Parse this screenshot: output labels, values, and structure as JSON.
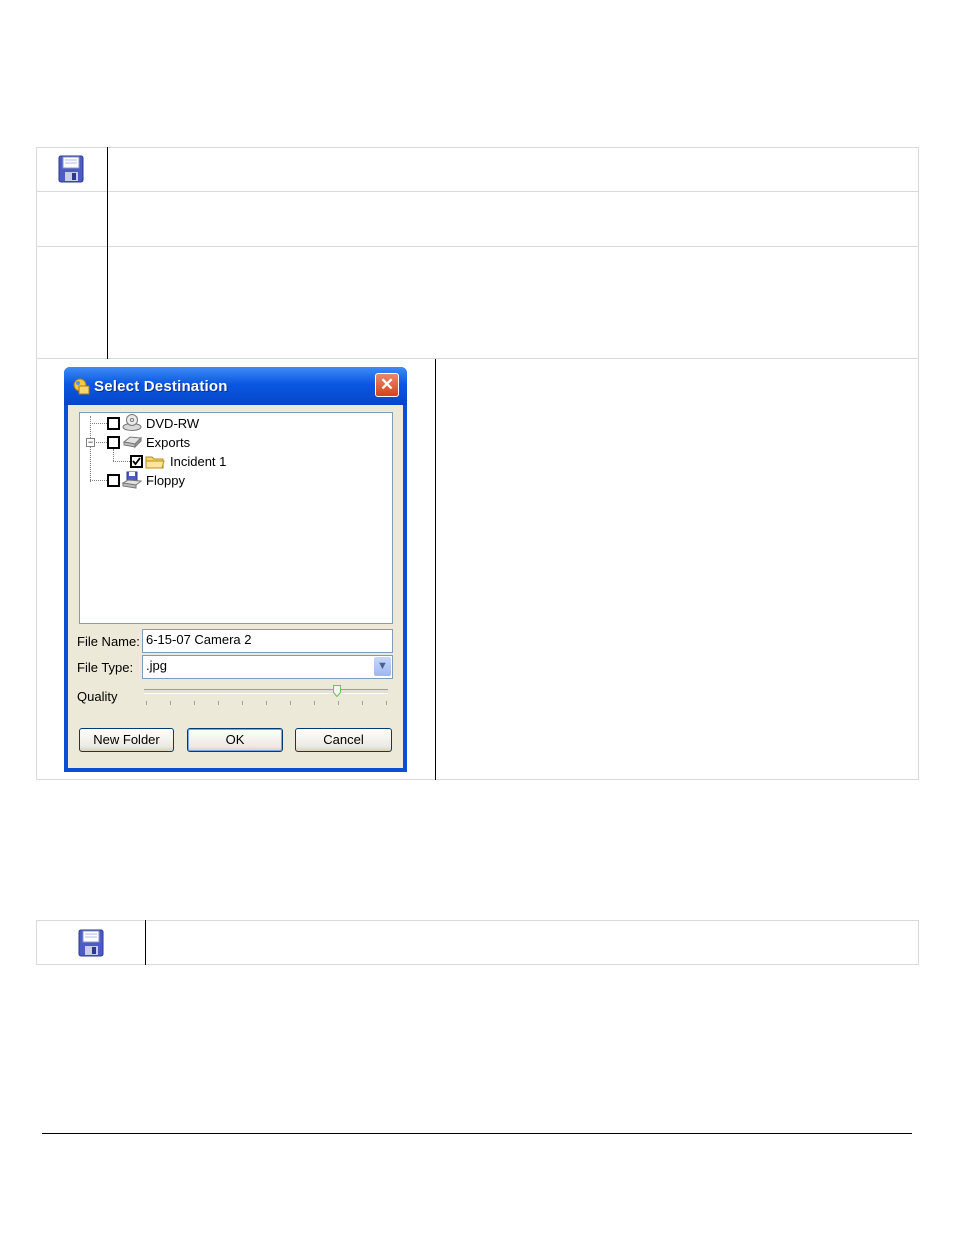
{
  "dialog": {
    "title": "Select Destination",
    "close_glyph": "✕",
    "tree": [
      {
        "label": "DVD-RW",
        "checked": false,
        "icon": "dvd-drive-icon"
      },
      {
        "label": "Exports",
        "checked": false,
        "icon": "hard-drive-icon",
        "expanded": true
      },
      {
        "label": "Incident 1",
        "checked": true,
        "icon": "folder-icon"
      },
      {
        "label": "Floppy",
        "checked": false,
        "icon": "floppy-drive-icon"
      }
    ],
    "file_name_label": "File Name:",
    "file_name_value": "6-15-07 Camera 2",
    "file_type_label": "File Type:",
    "file_type_value": ".jpg",
    "quality_label": "Quality",
    "quality_level": 0.8,
    "buttons": {
      "new_folder": "New Folder",
      "ok": "OK",
      "cancel": "Cancel"
    }
  },
  "icons": {
    "save_top": "floppy-save-icon",
    "save_bottom": "floppy-save-icon"
  },
  "colors": {
    "title_bar": "#0a57e3",
    "dialog_face": "#ece9d8",
    "close_button": "#d4421c"
  }
}
